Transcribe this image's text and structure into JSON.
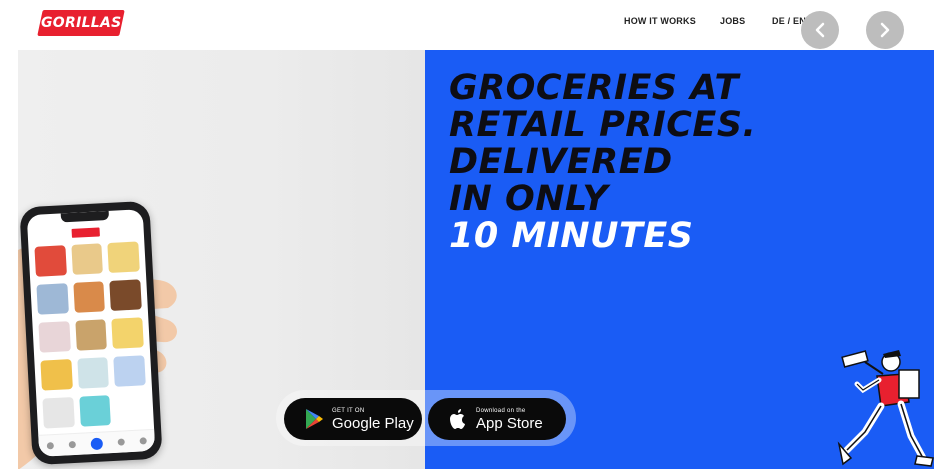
{
  "header": {
    "logo_text": "GORILLAS",
    "nav": [
      "HOW IT WORKS",
      "JOBS",
      "DE / EN"
    ]
  },
  "hero": {
    "headline_dark": [
      "GROCERIES AT",
      "RETAIL PRICES.",
      "DELIVERED",
      "IN ONLY"
    ],
    "headline_light": "10 MINUTES"
  },
  "stores": {
    "google_small": "GET IT ON",
    "google_big": "Google Play",
    "apple_small": "Download on the",
    "apple_big": "App Store"
  },
  "colors": {
    "brand_red": "#e8202f",
    "hero_blue": "#1a5cf5"
  }
}
